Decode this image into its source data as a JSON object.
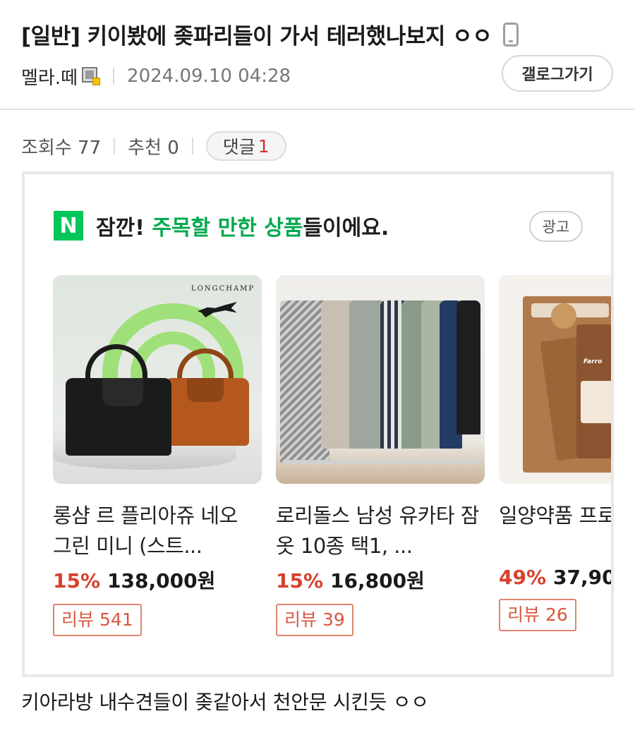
{
  "post": {
    "title": "[일반] 키이봤에 좆파리들이 가서 테러했나보지 ㅇㅇ",
    "author": "멜라.떼",
    "date": "2024.09.10 04:28",
    "gallery_button": "갤로그가기",
    "views_label": "조회수 77",
    "recommend_label": "추천 0",
    "comment_label": "댓글",
    "comment_count": "1",
    "body_text": "키아라방 내수견들이 좆같아서 천안문 시킨듯 ㅇㅇ"
  },
  "ad": {
    "logo": "N",
    "headline_prefix": "잠깐! ",
    "headline_highlight": "주목할 만한 상품",
    "headline_suffix": "들이에요.",
    "badge": "광고",
    "products": [
      {
        "name": "롱샴 르 플리아쥬 네오 그린 미니 (스트...",
        "discount": "15%",
        "price": "138,000원",
        "review": "리뷰 541",
        "brand_text": "LONGCHAMP"
      },
      {
        "name": "로리돌스 남성 유카타 잠옷 10종 택1, ...",
        "discount": "15%",
        "price": "16,800원",
        "review": "리뷰 39"
      },
      {
        "name": "일양약품 프로 발효효소",
        "discount": "49%",
        "price": "37,90",
        "review": "리뷰 26",
        "brand_text": "Farro"
      }
    ]
  },
  "colors": {
    "naver_green": "#03c75a",
    "discount_red": "#d8412b",
    "comment_count_red": "#d3302f",
    "review_border": "#e0846e"
  },
  "icons": {
    "title_device": "mobile-phone-icon",
    "author_badge": "fixed-nickname-icon"
  }
}
